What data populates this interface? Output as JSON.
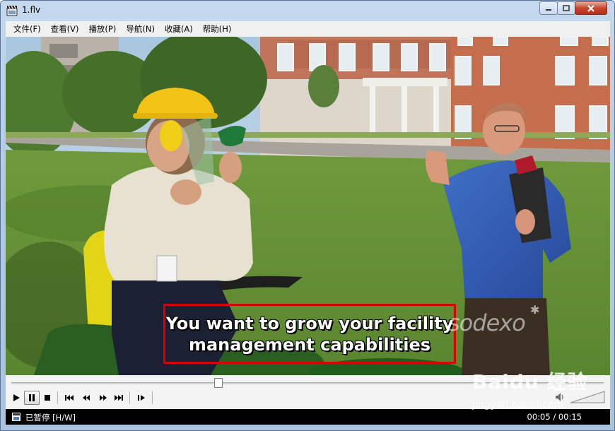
{
  "window": {
    "title": "1.flv"
  },
  "menu": {
    "items": [
      "文件(F)",
      "查看(V)",
      "播放(P)",
      "导航(N)",
      "收藏(A)",
      "帮助(H)"
    ]
  },
  "video": {
    "subtitle_lines": [
      "You want to grow your facility",
      "management capabilities"
    ],
    "brand_logo": "sodexo",
    "playback_progress": 0.35
  },
  "controls": {
    "buttons": [
      "play-icon",
      "pause-icon",
      "stop-icon",
      "skip-back-icon",
      "rewind-icon",
      "forward-icon",
      "skip-forward-icon",
      "frame-step-icon"
    ],
    "volume_icon": "speaker-icon"
  },
  "status": {
    "state": "已暂停 [H/W]",
    "time": "00:05 / 00:15"
  },
  "watermark": {
    "logo": "Baidu 经验",
    "url": "jingyan.baidu.com"
  }
}
